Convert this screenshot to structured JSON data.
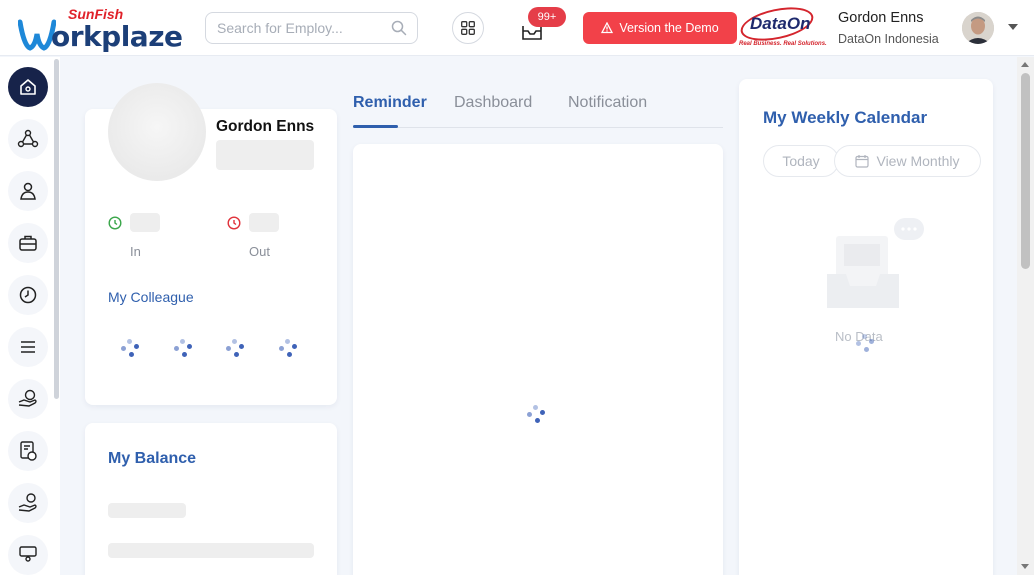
{
  "header": {
    "logo_small": "SunFish",
    "logo_main": "orkplaze",
    "search_placeholder": "Search for Employ...",
    "notification_badge": "99+",
    "demo_button": "Version the Demo",
    "partner_logo": "DataOn",
    "partner_tagline": "Real Business. Real Solutions.",
    "user_name": "Gordon Enns",
    "user_company": "DataOn Indonesia"
  },
  "sidebar": {
    "items": [
      {
        "name": "home-icon",
        "active": true
      },
      {
        "name": "org-chart-icon",
        "active": false
      },
      {
        "name": "profile-icon",
        "active": false
      },
      {
        "name": "briefcase-icon",
        "active": false
      },
      {
        "name": "clock-icon",
        "active": false
      },
      {
        "name": "menu-icon",
        "active": false
      },
      {
        "name": "hand-money-icon",
        "active": false
      },
      {
        "name": "document-money-icon",
        "active": false
      },
      {
        "name": "payment-icon",
        "active": false
      },
      {
        "name": "training-icon",
        "active": false
      }
    ]
  },
  "profile": {
    "name": "Gordon Enns",
    "in_label": "In",
    "out_label": "Out",
    "colleague_title": "My Colleague"
  },
  "balance": {
    "title": "My Balance"
  },
  "center": {
    "tabs": [
      "Reminder",
      "Dashboard",
      "Notification"
    ],
    "active_tab": "Reminder"
  },
  "calendar": {
    "title": "My Weekly Calendar",
    "today_label": "Today",
    "monthly_label": "View Monthly",
    "empty_text": "No Data"
  },
  "colors": {
    "accent": "#2f5fad",
    "nav_active": "#17234a",
    "demo_red": "#f24149",
    "badge_red": "#e53d48"
  }
}
